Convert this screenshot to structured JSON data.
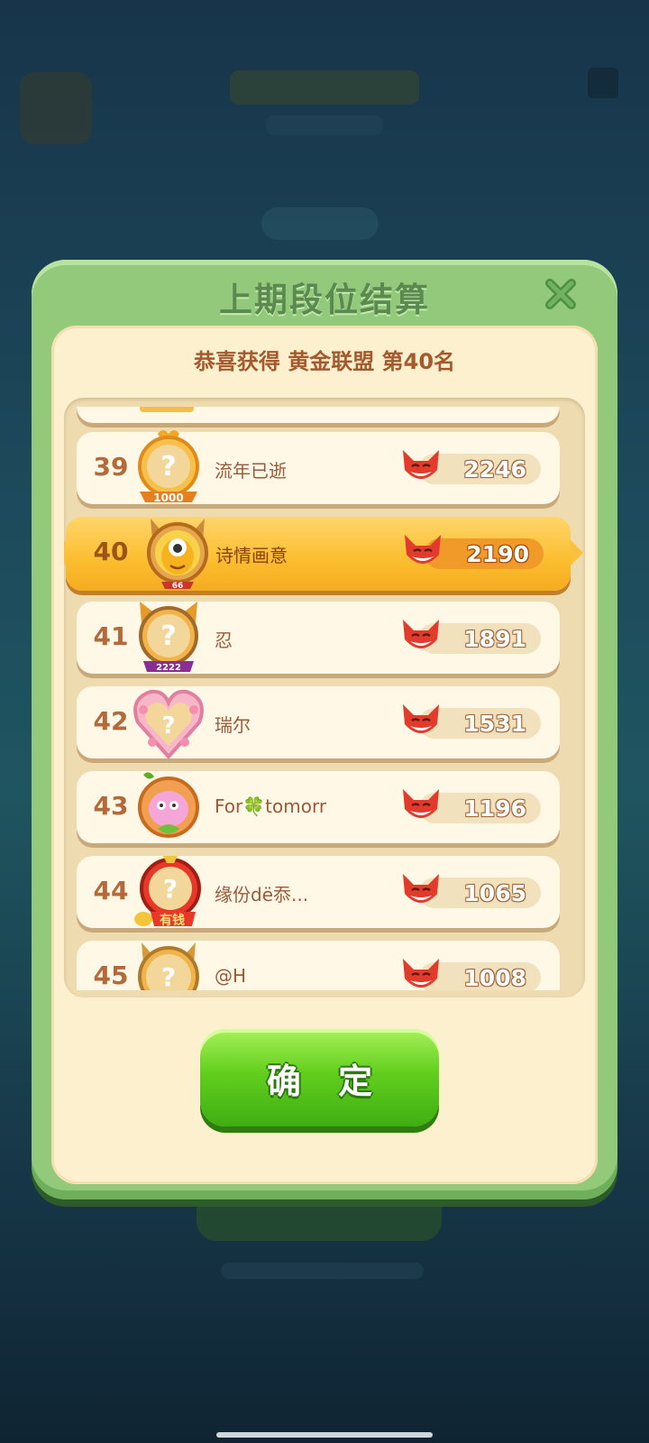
{
  "dialog": {
    "title": "上期段位结算",
    "congrats": "恭喜获得 黄金联盟 第40名",
    "confirm_label": "确 定"
  },
  "players": [
    {
      "rank": "39",
      "name": "流年已逝",
      "score": "2246",
      "frame": "gold-chicken-1000",
      "highlight": false
    },
    {
      "rank": "40",
      "name": "诗情画意",
      "score": "2190",
      "frame": "cat-ears-66",
      "highlight": true
    },
    {
      "rank": "41",
      "name": "忍",
      "score": "1891",
      "frame": "cat-ribbon-2222",
      "highlight": false
    },
    {
      "rank": "42",
      "name": "瑞尔",
      "score": "1531",
      "frame": "pink-flower-heart",
      "highlight": false
    },
    {
      "rank": "43",
      "name": "For🍀tomorr",
      "score": "1196",
      "frame": "pink-blob-clover",
      "highlight": false
    },
    {
      "rank": "44",
      "name": "缘份dë忝...",
      "score": "1065",
      "frame": "red-money-bag",
      "highlight": false
    },
    {
      "rank": "45",
      "name": "@H",
      "score": "1008",
      "frame": "cat-ears-crown",
      "highlight": false
    }
  ],
  "avatar_badges": {
    "r39": "1000",
    "r40": "66",
    "r41": "2222",
    "r44": "有钱"
  },
  "colors": {
    "accent_green": "#62cf1e",
    "highlight_gold": "#fbbd2f",
    "text_brown": "#a35a2e"
  }
}
